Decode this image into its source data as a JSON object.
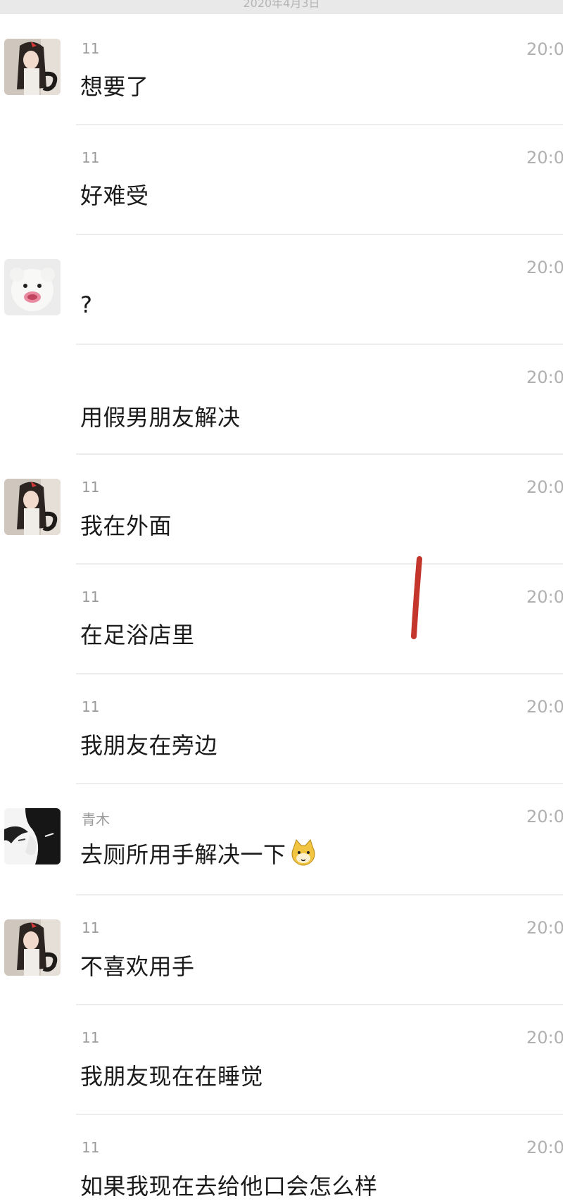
{
  "header": {
    "date_label": "2020年4月3日"
  },
  "messages": [
    {
      "avatar": "girl-avatar-icon",
      "sender": "11",
      "text": "想要了",
      "time": "20:0"
    },
    {
      "avatar": "",
      "sender": "11",
      "text": "好难受",
      "time": "20:0"
    },
    {
      "avatar": "bear-avatar-icon",
      "sender": "",
      "text": "?",
      "time": "20:0"
    },
    {
      "avatar": "",
      "sender": "",
      "text": "用假男朋友解决",
      "time": "20:0"
    },
    {
      "avatar": "girl-avatar-icon",
      "sender": "11",
      "text": "我在外面",
      "time": "20:0"
    },
    {
      "avatar": "",
      "sender": "11",
      "text": "在足浴店里",
      "time": "20:0"
    },
    {
      "avatar": "",
      "sender": "11",
      "text": "我朋友在旁边",
      "time": "20:0"
    },
    {
      "avatar": "anime-avatar-icon",
      "sender": "青木",
      "text": "去厕所用手解决一下",
      "emoji": "cat-face-emoji-icon",
      "time": "20:0"
    },
    {
      "avatar": "girl-avatar-icon",
      "sender": "11",
      "text": "不喜欢用手",
      "time": "20:0"
    },
    {
      "avatar": "",
      "sender": "11",
      "text": "我朋友现在在睡觉",
      "time": "20:0"
    },
    {
      "avatar": "",
      "sender": "11",
      "text": "如果我现在去给他口会怎么样",
      "time": "20:0"
    }
  ],
  "colors": {
    "background": "#ffffff",
    "header_bar": "#e9e9e9",
    "sender_gray": "#9a9a9a",
    "time_gray": "#b0b0b0",
    "divider": "#ededed",
    "annotation_red": "#c4352b"
  }
}
